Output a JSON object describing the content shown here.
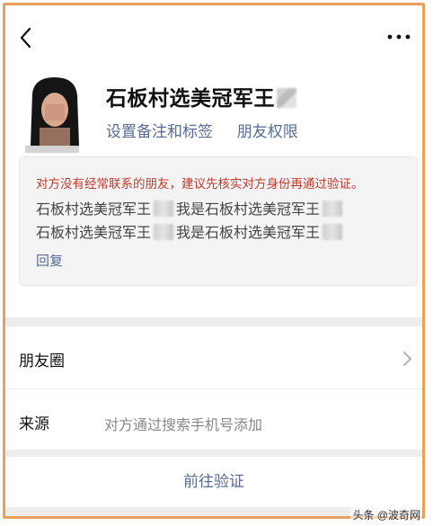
{
  "profile": {
    "name": "石板村选美冠军王",
    "set_remark": "设置备注和标签",
    "friend_permission": "朋友权限"
  },
  "verify": {
    "warning": "对方没有经常联系的朋友，建议先核实对方身份再通过验证。",
    "messages": [
      {
        "sender": "石板村选美冠军王",
        "text": "我是石板村选美冠军王"
      },
      {
        "sender": "石板村选美冠军王",
        "text": "我是石板村选美冠军王"
      }
    ],
    "reply_label": "回复"
  },
  "rows": {
    "moments_label": "朋友圈",
    "source_label": "来源",
    "source_value": "对方通过搜索手机号添加"
  },
  "action": {
    "verify_label": "前往验证"
  },
  "watermark": "头条 @波奇网",
  "icons": {
    "back": "chevron-left-icon",
    "more": "more-dots-icon",
    "chevron": "chevron-right-icon"
  },
  "colors": {
    "link": "#576b95",
    "warning": "#c0392b",
    "separator": "#ededed"
  }
}
